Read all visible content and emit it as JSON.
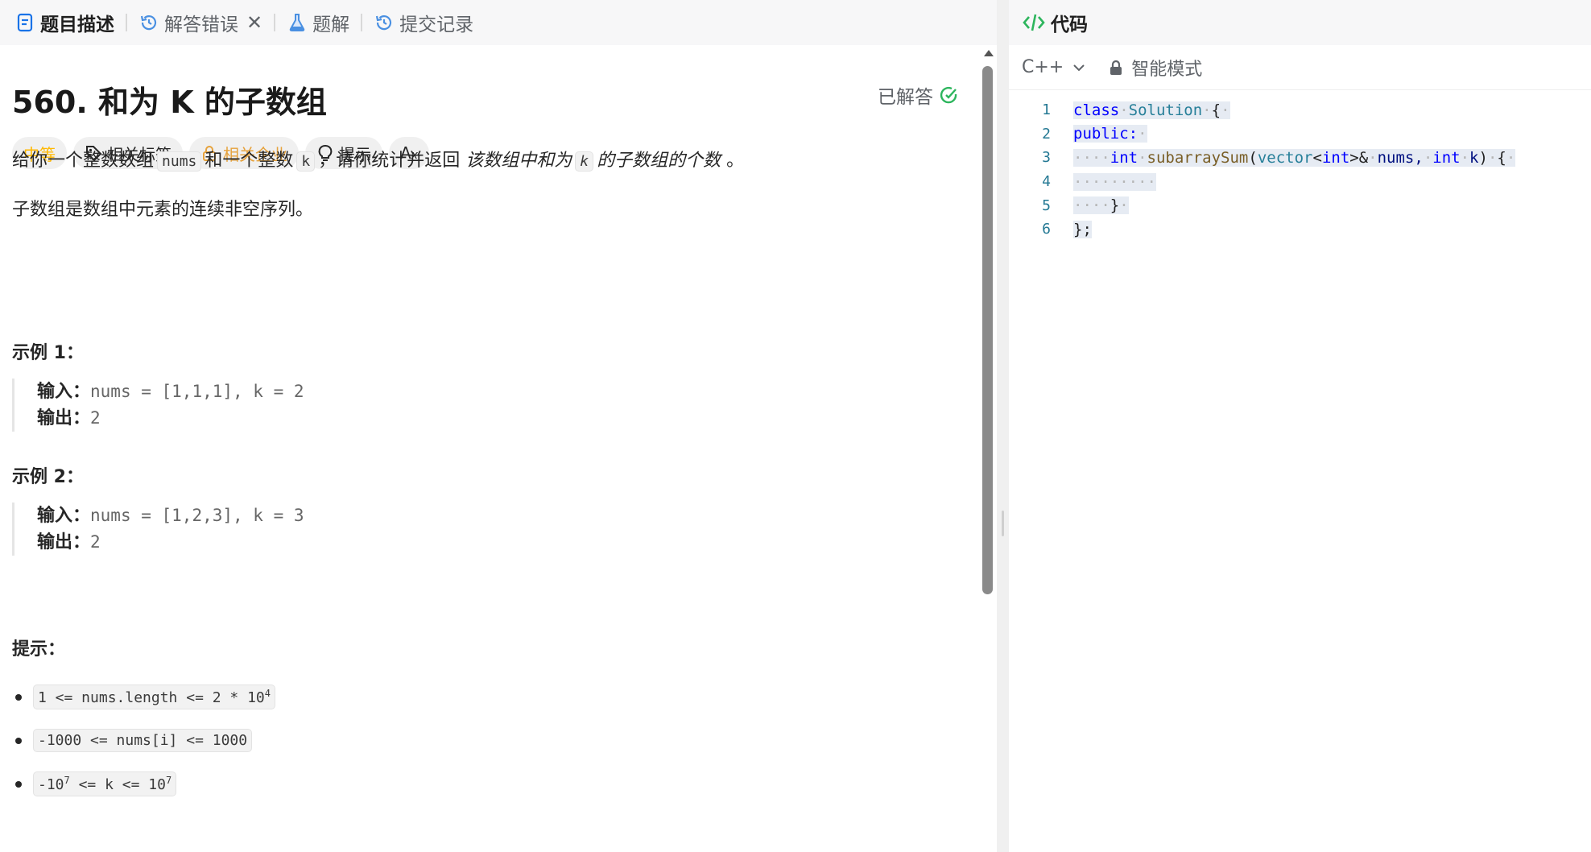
{
  "tabs": [
    {
      "label": "题目描述",
      "icon": "description-icon",
      "active": true
    },
    {
      "label": "解答错误",
      "icon": "history-icon",
      "closable": true
    },
    {
      "label": "题解",
      "icon": "flask-icon"
    },
    {
      "label": "提交记录",
      "icon": "history-icon"
    }
  ],
  "problem": {
    "title": "560. 和为 K 的子数组",
    "status": "已解答",
    "tags": {
      "difficulty": "中等",
      "related_tags": "相关标签",
      "companies": "相关企业",
      "hint": "提示",
      "translate": "A",
      "translate_sub": "x"
    },
    "desc1": {
      "p1": "给你一个整数数组",
      "c1": "nums",
      "p2": "和一个整数",
      "c2": "k",
      "p3": "，请你统计并返回",
      "i1": "该数组中和为",
      "c3": "k",
      "i2": "的子数组的个数",
      "p4": "。"
    },
    "desc2": "子数组是数组中元素的连续非空序列。",
    "examples": [
      {
        "heading": "示例 1：",
        "input_label": "输入：",
        "input": "nums = [1,1,1], k = 2",
        "output_label": "输出：",
        "output": "2"
      },
      {
        "heading": "示例 2：",
        "input_label": "输入：",
        "input": "nums = [1,2,3], k = 3",
        "output_label": "输出：",
        "output": "2"
      }
    ],
    "constraints_heading": "提示：",
    "constraints": [
      {
        "text": "1 <= nums.length <= 2 * 10",
        "sup": "4",
        "tail": ""
      },
      {
        "text": "-1000 <= nums[i] <= 1000",
        "sup": "",
        "tail": ""
      },
      {
        "text": "-10",
        "sup": "7",
        "tail": " <= k <= 10",
        "sup2": "7"
      }
    ]
  },
  "editor": {
    "header": "代码",
    "language": "C++",
    "mode": "智能模式",
    "line_numbers": [
      "1",
      "2",
      "3",
      "4",
      "5",
      "6"
    ],
    "code": {
      "l1_kw": "class",
      "l1_name": "Solution",
      "l1_brace": "{",
      "l2": "public:",
      "l3_int": "int",
      "l3_fn": "subarraySum",
      "l3_open": "(",
      "l3_vec": "vector",
      "l3_lt": "<",
      "l3_int2": "int",
      "l3_gt": ">&",
      "l3_nums": "nums,",
      "l3_int3": "int",
      "l3_k": "k",
      "l3_close": ")",
      "l3_brace": "{",
      "l5": "}",
      "l6": "};"
    }
  },
  "colors": {
    "accent_blue": "#1a73e8",
    "check_green": "#2db55d",
    "difficulty_yellow": "#ffb800"
  }
}
